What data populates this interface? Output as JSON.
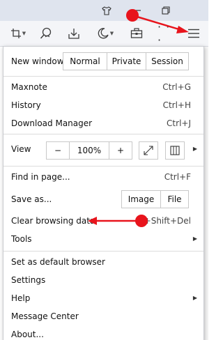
{
  "titlebar": {
    "icons": [
      "shirt-icon",
      "minimize-icon",
      "restore-icon"
    ]
  },
  "toolbar": {
    "icons": [
      "screenshot-icon",
      "search-voice-icon",
      "download-icon",
      "night-mode-icon",
      "toolbox-icon",
      "more-icon",
      "menu-icon"
    ],
    "more_label": "· · ·"
  },
  "menu": {
    "new_window": {
      "label": "New window",
      "options": [
        "Normal",
        "Private",
        "Session"
      ]
    },
    "maxnote": {
      "label": "Maxnote",
      "shortcut": "Ctrl+G"
    },
    "history": {
      "label": "History",
      "shortcut": "Ctrl+H"
    },
    "download_manager": {
      "label": "Download Manager",
      "shortcut": "Ctrl+J"
    },
    "view": {
      "label": "View",
      "zoom_out": "−",
      "zoom_level": "100%",
      "zoom_in": "+"
    },
    "find_in_page": {
      "label": "Find in page...",
      "shortcut": "Ctrl+F"
    },
    "save_as": {
      "label": "Save as...",
      "options": [
        "Image",
        "File"
      ]
    },
    "clear_browsing_data": {
      "label": "Clear browsing data",
      "shortcut": "l+Shift+Del"
    },
    "tools": {
      "label": "Tools"
    },
    "set_default": {
      "label": "Set as default browser"
    },
    "settings": {
      "label": "Settings"
    },
    "help": {
      "label": "Help"
    },
    "message_center": {
      "label": "Message Center"
    },
    "about": {
      "label": "About..."
    }
  },
  "annotation": {
    "color": "#e8141c"
  }
}
